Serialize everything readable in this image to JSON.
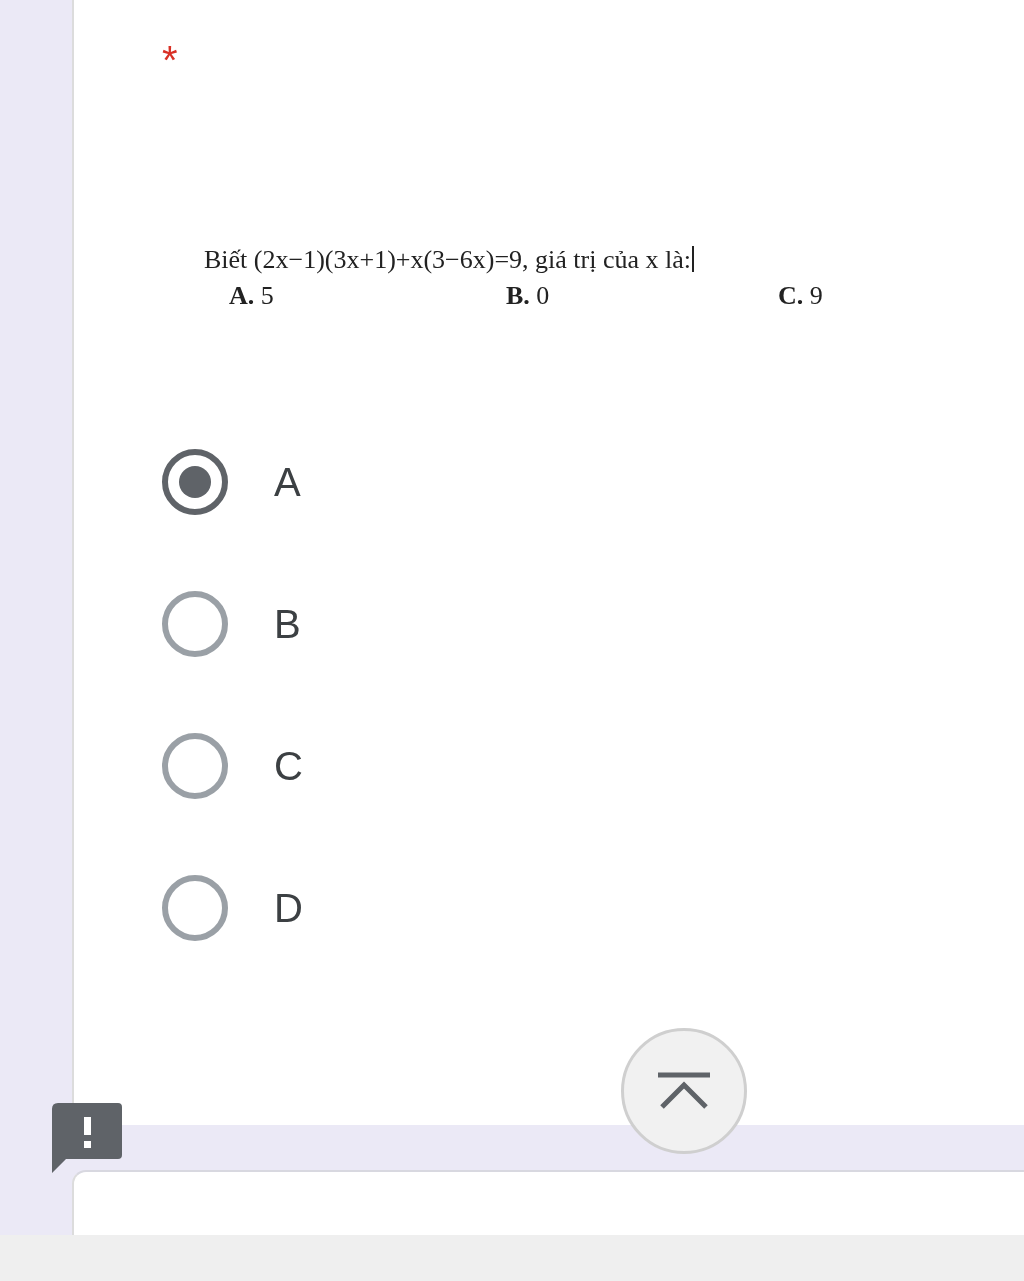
{
  "question": {
    "required_mark": "*",
    "text": "Biết (2x−1)(3x+1)+x(3−6x)=9, giá trị của x là:",
    "choices": [
      "**A.** 5",
      "**B.** 0",
      "**C.** 9"
    ]
  },
  "options": [
    {
      "label": "A",
      "selected": true
    },
    {
      "label": "B",
      "selected": false
    },
    {
      "label": "C",
      "selected": false
    },
    {
      "label": "D",
      "selected": false
    }
  ]
}
